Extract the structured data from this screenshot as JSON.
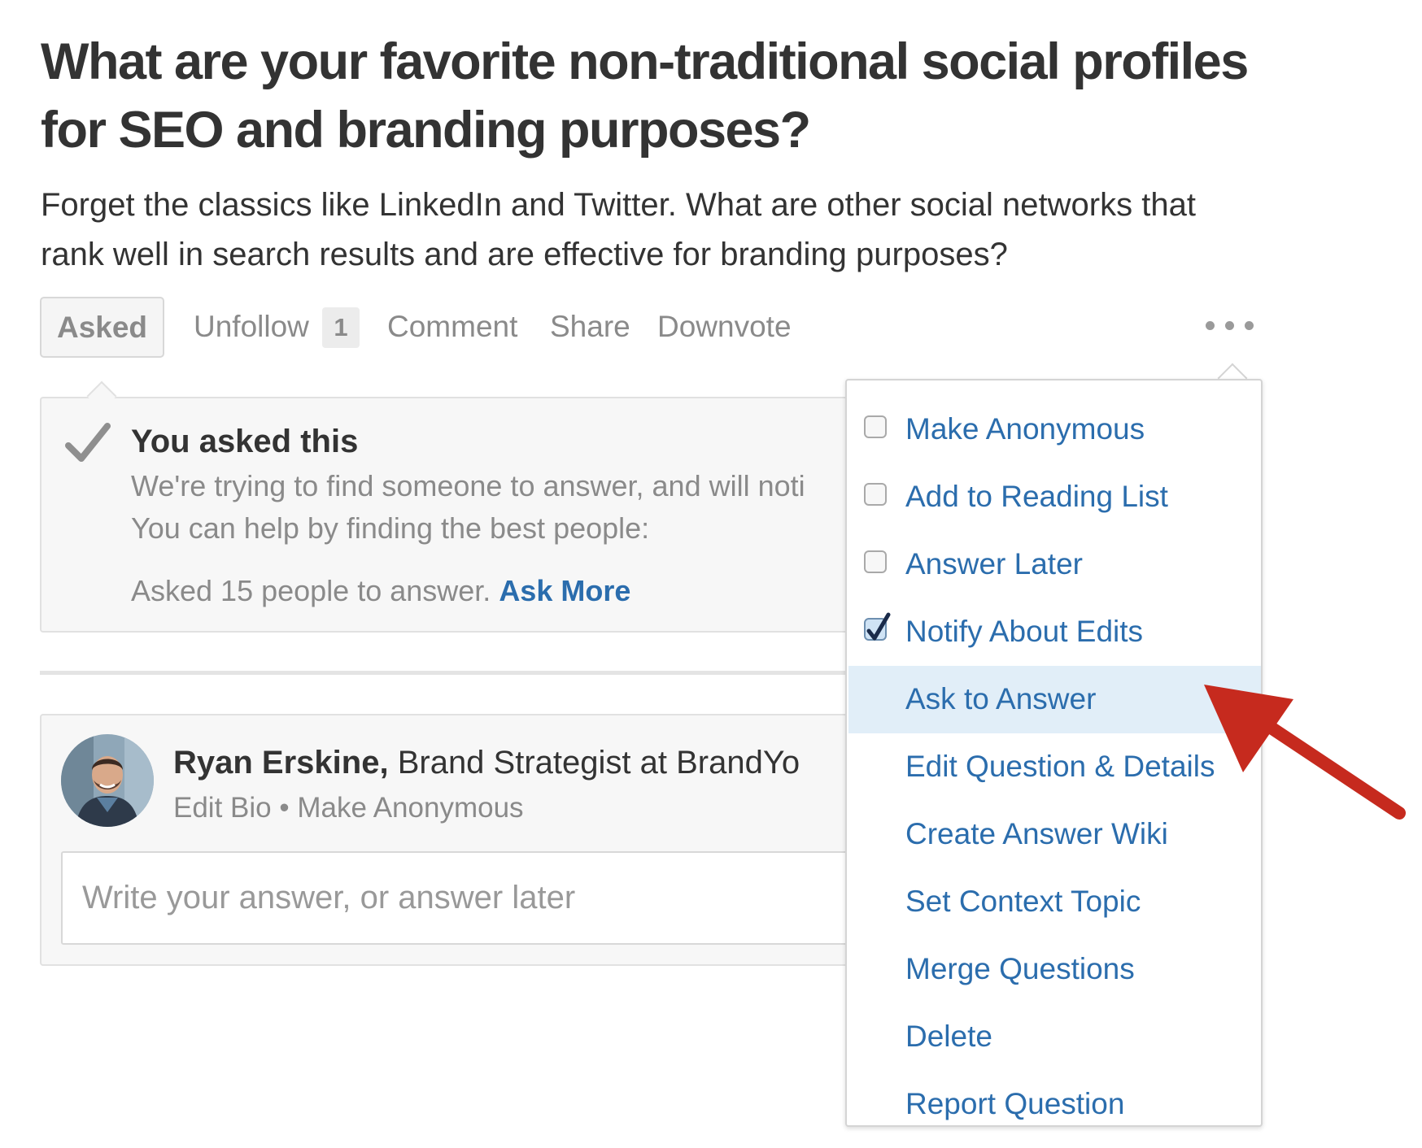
{
  "question": {
    "title": "What are your favorite non-traditional social profiles for SEO and branding purposes?",
    "details": "Forget the classics like LinkedIn and Twitter. What are other social networks that rank well in search results and are effective for branding purposes?"
  },
  "actions": {
    "asked": "Asked",
    "unfollow": "Unfollow",
    "follow_count": "1",
    "comment": "Comment",
    "share": "Share",
    "downvote": "Downvote",
    "more_icon": "ellipsis-icon"
  },
  "asked_panel": {
    "heading": "You asked this",
    "line1": "We're trying to find someone to answer, and will noti",
    "line2": "You can help by finding the best people:",
    "asked_count_text": "Asked 15 people to answer. ",
    "ask_more": "Ask More",
    "icon": "checkmark-icon"
  },
  "answer": {
    "author_name": "Ryan Erskine,",
    "author_title": " Brand Strategist at BrandYo",
    "edit_bio": "Edit Bio",
    "separator": " • ",
    "make_anonymous": "Make Anonymous",
    "placeholder": "Write your answer, or answer later"
  },
  "menu": {
    "items": [
      {
        "label": "Make Anonymous",
        "checkbox": true,
        "checked": false
      },
      {
        "label": "Add to Reading List",
        "checkbox": true,
        "checked": false
      },
      {
        "label": "Answer Later",
        "checkbox": true,
        "checked": false
      },
      {
        "label": "Notify About Edits",
        "checkbox": true,
        "checked": true
      },
      {
        "label": "Ask to Answer",
        "checkbox": false,
        "highlighted": true
      },
      {
        "label": "Edit Question & Details",
        "checkbox": false
      },
      {
        "label": "Create Answer Wiki",
        "checkbox": false
      },
      {
        "label": "Set Context Topic",
        "checkbox": false
      },
      {
        "label": "Merge Questions",
        "checkbox": false
      },
      {
        "label": "Delete",
        "checkbox": false
      },
      {
        "label": "Report Question",
        "checkbox": false
      }
    ]
  },
  "colors": {
    "link": "#2b6dad",
    "muted": "#8a8a8a",
    "highlight": "#e1eef8",
    "arrow": "#c62a1e"
  }
}
